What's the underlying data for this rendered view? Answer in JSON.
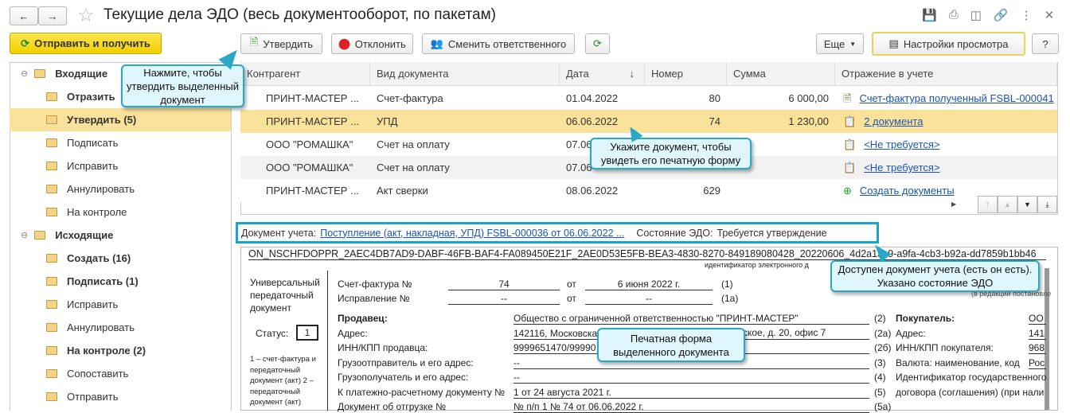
{
  "window": {
    "title": "Текущие дела ЭДО (весь документооборот, по пакетам)"
  },
  "toolbar": {
    "send_receive": "Отправить и получить",
    "approve": "Утвердить",
    "reject": "Отклонить",
    "change_responsible": "Сменить ответственного",
    "more": "Еще",
    "view_settings": "Настройки просмотра",
    "help": "?"
  },
  "sidebar": {
    "items": [
      {
        "label": "Входящие",
        "bold": true,
        "group": true
      },
      {
        "label": "Отразить",
        "bold": true
      },
      {
        "label": "Утвердить (5)",
        "bold": true,
        "selected": true
      },
      {
        "label": "Подписать"
      },
      {
        "label": "Исправить"
      },
      {
        "label": "Аннулировать"
      },
      {
        "label": "На контроле"
      },
      {
        "label": "Исходящие",
        "bold": true,
        "group": true
      },
      {
        "label": "Создать (16)",
        "bold": true
      },
      {
        "label": "Подписать (1)",
        "bold": true
      },
      {
        "label": "Исправить"
      },
      {
        "label": "Аннулировать"
      },
      {
        "label": "На контроле (2)",
        "bold": true
      },
      {
        "label": "Сопоставить",
        "top": true
      },
      {
        "label": "Отправить",
        "top": true
      }
    ]
  },
  "table": {
    "columns": [
      "Контрагент",
      "Вид документа",
      "Дата",
      "Номер",
      "Сумма",
      "Отражение в учете"
    ],
    "rows": [
      {
        "contractor": "ПРИНТ-МАСТЕР ...",
        "type": "Счет-фактура",
        "date": "01.04.2022",
        "number": "80",
        "sum": "6 000,00",
        "reflection": "Счет-фактура полученный FSBL-000041"
      },
      {
        "contractor": "ПРИНТ-МАСТЕР ...",
        "type": "УПД",
        "date": "06.06.2022",
        "number": "74",
        "sum": "1 230,00",
        "reflection": "2 документа"
      },
      {
        "contractor": "ООО \"РОМАШКА\"",
        "type": "Счет на оплату",
        "date": "07.06",
        "number": "",
        "sum": "",
        "reflection": "<Не требуется>"
      },
      {
        "contractor": "ООО \"РОМАШКА\"",
        "type": "Счет на оплату",
        "date": "07.06",
        "number": "",
        "sum": "",
        "reflection": "<Не требуется>"
      },
      {
        "contractor": "ПРИНТ-МАСТЕР ...",
        "type": "Акт сверки",
        "date": "08.06.2022",
        "number": "629",
        "sum": "",
        "reflection": "Создать документы"
      }
    ]
  },
  "info": {
    "doc_label": "Документ учета:",
    "doc_link": "Поступление (акт, накладная, УПД) FSBL-000036 от 06.06.2022 ...",
    "state_label": "Состояние ЭДО:",
    "state_value": "Требуется утверждение"
  },
  "print_form": {
    "file_id": "ON_NSCHFDOPPR_2AEC4DB7AD9-DABF-46FB-BAF4-FA089450E21F_2AE0D53E5FB-BEA3-4830-8270-849189080428_20220606_4d2a13c9-a9fa-4cb3-b92a-dd7859b1bb46",
    "file_id_caption": "идентификатор электронного д",
    "doc_kind": "Универсальный передаточный документ",
    "status_label": "Статус:",
    "status_value": "1",
    "status_note": "1 – счет-фактура и передаточный документ (акт) 2 – передаточный документ (акт)",
    "invoice_label": "Счет-фактура №",
    "invoice_no": "74",
    "from": "от",
    "invoice_date": "6 июня 2022 г.",
    "n1": "(1)",
    "fix_label": "Исправление №",
    "fix_no": "--",
    "fix_date": "--",
    "n1a": "(1а)",
    "edition": "(в редакции постановле",
    "seller_label": "Продавец:",
    "seller": "Общество с ограниченной ответственностью \"ПРИНТ-МАСТЕР\"",
    "n2": "(2)",
    "addr_label": "Адрес:",
    "addr": "142116, Московска",
    "addr_tail": "ское, д. 20, офис 7",
    "n2a": "(2а)",
    "inn_label": "ИНН/КПП продавца:",
    "inn": "9999651470/99990",
    "n2b": "(2б)",
    "shipper_label": "Грузоотправитель и его адрес:",
    "shipper": "--",
    "n3": "(3)",
    "consignee_label": "Грузополучатель и его адрес:",
    "consignee": "--",
    "n4": "(4)",
    "payment_label": "К платежно-расчетному документу №",
    "payment": "1 от 24 августа 2021 г.",
    "n5": "(5)",
    "shipment_label": "Документ об отгрузке №",
    "shipment": "№ п/п 1 № 74 от 06.06.2022 г.",
    "n5a": "(5а)",
    "buyer_label": "Покупатель:",
    "buyer": "ОО",
    "buyer_addr_label": "Адрес:",
    "buyer_addr": "141",
    "buyer_inn_label": "ИНН/КПП покупателя:",
    "buyer_inn": "968",
    "currency_label": "Валюта: наименование, код",
    "currency": "Рос",
    "gov_id_label": "Идентификатор государственного",
    "gov_id_label2": "договора (соглашения) (при нали"
  },
  "callouts": {
    "approve": "Нажмите, чтобы утвердить выделенный документ",
    "select": "Укажите документ, чтобы увидеть его печатную форму",
    "accounting": "Доступен документ учета (есть он есть). Указано состояние ЭДО",
    "print": "Печатная форма выделенного документа"
  },
  "colors": {
    "accent_yellow": "#f5d40a",
    "selected_row": "#fbe29a",
    "callout_border": "#2aa8c9",
    "link": "#1a55b5"
  }
}
